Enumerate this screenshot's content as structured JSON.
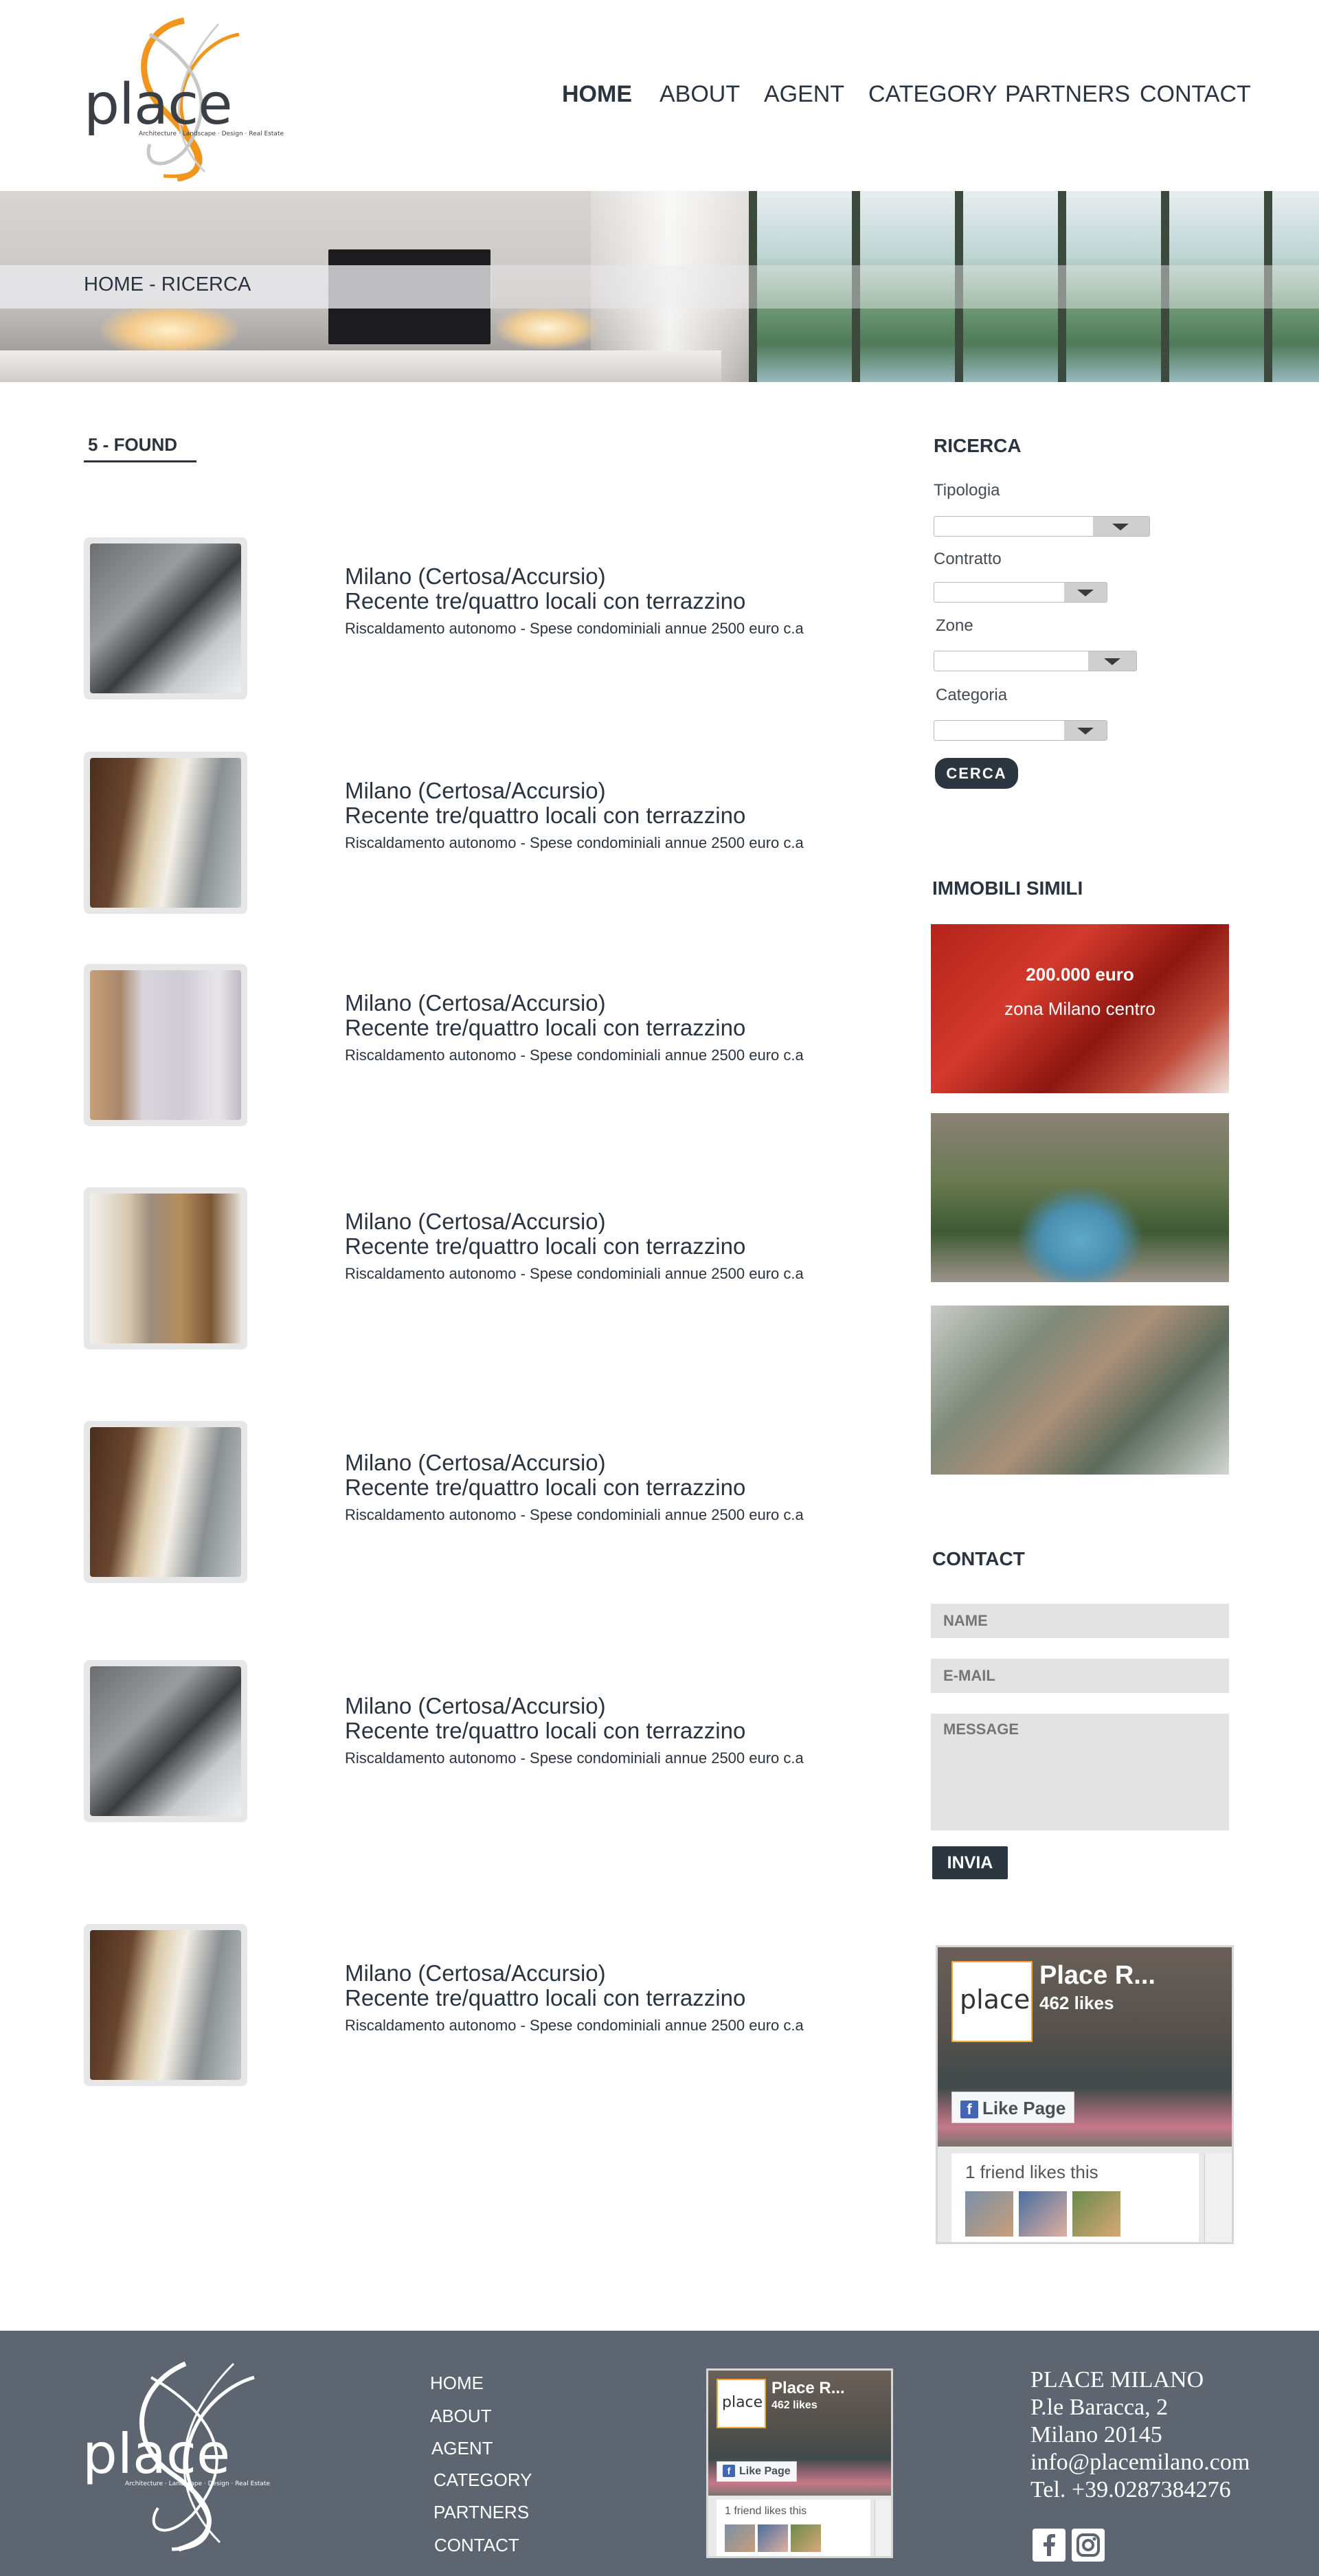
{
  "brand": {
    "logo_text": "place",
    "logo_tagline": "Architecture · Landscape · Design · Real Estate"
  },
  "nav": {
    "items": [
      {
        "label": "HOME",
        "active": true
      },
      {
        "label": "ABOUT",
        "active": false
      },
      {
        "label": "AGENT",
        "active": false
      },
      {
        "label": "CATEGORY",
        "active": false
      },
      {
        "label": "PARTNERS",
        "active": false
      },
      {
        "label": "CONTACT",
        "active": false
      }
    ]
  },
  "breadcrumb": "HOME - RICERCA",
  "results": {
    "count_label": "5 - FOUND",
    "listings": [
      {
        "title": "Milano (Certosa/Accursio)",
        "subtitle": "Recente tre/quattro locali con terrazzino",
        "description": "Riscaldamento autonomo - Spese condominiali annue 2500 euro c.a"
      },
      {
        "title": "Milano (Certosa/Accursio)",
        "subtitle": "Recente tre/quattro locali con terrazzino",
        "description": "Riscaldamento autonomo - Spese condominiali annue 2500 euro c.a"
      },
      {
        "title": "Milano (Certosa/Accursio)",
        "subtitle": "Recente tre/quattro locali con terrazzino",
        "description": "Riscaldamento autonomo - Spese condominiali annue 2500 euro c.a"
      },
      {
        "title": "Milano (Certosa/Accursio)",
        "subtitle": "Recente tre/quattro locali con terrazzino",
        "description": "Riscaldamento autonomo - Spese condominiali annue 2500 euro c.a"
      },
      {
        "title": "Milano (Certosa/Accursio)",
        "subtitle": "Recente tre/quattro locali con terrazzino",
        "description": "Riscaldamento autonomo - Spese condominiali annue 2500 euro c.a"
      },
      {
        "title": "Milano (Certosa/Accursio)",
        "subtitle": "Recente tre/quattro locali con terrazzino",
        "description": "Riscaldamento autonomo - Spese condominiali annue 2500 euro c.a"
      },
      {
        "title": "Milano (Certosa/Accursio)",
        "subtitle": "Recente tre/quattro locali con terrazzino",
        "description": "Riscaldamento autonomo - Spese condominiali annue 2500 euro c.a"
      }
    ]
  },
  "search": {
    "heading": "RICERCA",
    "fields": [
      {
        "label": "Tipologia",
        "value": ""
      },
      {
        "label": "Contratto",
        "value": ""
      },
      {
        "label": "Zone",
        "value": ""
      },
      {
        "label": "Categoria",
        "value": ""
      }
    ],
    "button_label": "CERCA"
  },
  "similar": {
    "heading": "IMMOBILI SIMILI",
    "featured_price": "200.000 euro",
    "featured_zone": "zona Milano centro"
  },
  "contact": {
    "heading": "CONTACT",
    "name_placeholder": "NAME",
    "email_placeholder": "E-MAIL",
    "message_placeholder": "MESSAGE",
    "submit_label": "INVIA"
  },
  "facebook": {
    "page_name": "Place R...",
    "likes": "462 likes",
    "like_button": "Like Page",
    "friends_text": "1 friend likes this",
    "logo_text": "place"
  },
  "footer": {
    "nav": [
      "HOME",
      "ABOUT",
      "AGENT",
      "CATEGORY",
      "PARTNERS",
      "CONTACT"
    ],
    "address": {
      "name": "PLACE MILANO",
      "street": "P.le Baracca, 2",
      "city": "Milano 20145",
      "email": "info@placemilano.com",
      "phone": "Tel. +39.0287384276"
    },
    "social": [
      "facebook-icon",
      "instagram-icon"
    ]
  },
  "colors": {
    "accent_orange": "#f0961e",
    "dark_navy": "#2b3640",
    "footer_bg": "#5d6670"
  }
}
